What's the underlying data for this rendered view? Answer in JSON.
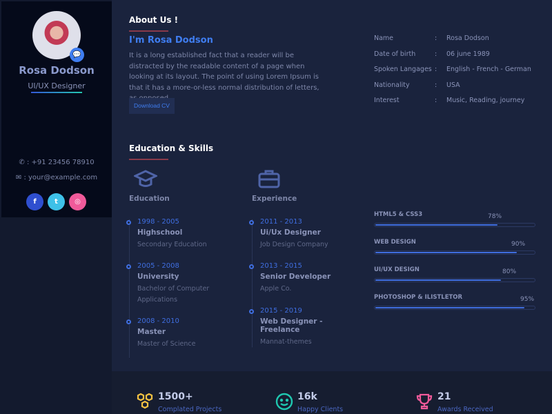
{
  "profile": {
    "name": "Rosa Dodson",
    "role": "UI/UX Designer",
    "phone": ": +91 23456 78910",
    "email": ": your@example.com",
    "socials": [
      {
        "icon": "facebook-icon",
        "glyph": "f",
        "color": "#2f4fcf"
      },
      {
        "icon": "twitter-icon",
        "glyph": "t",
        "color": "#3ec1e8"
      },
      {
        "icon": "dribbble-icon",
        "glyph": "◎",
        "color": "#f05a9a"
      }
    ]
  },
  "about": {
    "heading": "About Us !",
    "intro_name": "I'm Rosa Dodson",
    "text": "It is a long established fact that a reader will be distracted by the readable content of a page when looking at its layout. The point of using Lorem Ipsum is that it has a more-or-less normal distribution of letters, as opposed.",
    "download_label": "Download CV",
    "info": [
      {
        "k": "Name",
        "v": "Rosa Dodson"
      },
      {
        "k": "Date of birth",
        "v": "06 june 1989"
      },
      {
        "k": "Spoken Langages",
        "v": "English - French - German"
      },
      {
        "k": "Nationality",
        "v": "USA"
      },
      {
        "k": "Interest",
        "v": "Music, Reading, journey"
      }
    ],
    "sep": ":"
  },
  "edu_skills": {
    "heading": "Education & Skills",
    "education_title": "Education",
    "experience_title": "Experience",
    "education": [
      {
        "y": "1998 - 2005",
        "t": "Highschool",
        "s": "Secondary Education"
      },
      {
        "y": "2005 - 2008",
        "t": "University",
        "s": "Bachelor of Computer Applications"
      },
      {
        "y": "2008 - 2010",
        "t": "Master",
        "s": "Master of Science"
      }
    ],
    "experience": [
      {
        "y": "2011 - 2013",
        "t": "Ui/Ux Designer",
        "s": "Job Design Company"
      },
      {
        "y": "2013 - 2015",
        "t": "Senior Developer",
        "s": "Apple Co."
      },
      {
        "y": "2015 - 2019",
        "t": "Web Designer - Freelance",
        "s": "Mannat-themes"
      }
    ],
    "skills": [
      {
        "name": "HTML5 & CSS3",
        "pct": "78%",
        "value": 78
      },
      {
        "name": "WEB DESIGN",
        "pct": "90%",
        "value": 90
      },
      {
        "name": "UI/UX DESIGN",
        "pct": "80%",
        "value": 80
      },
      {
        "name": "PHOTOSHOP & ILISTLETOR",
        "pct": "95%",
        "value": 95
      }
    ]
  },
  "stats": [
    {
      "value": "1500+",
      "label": "Complated Projects",
      "color": "#f5c242"
    },
    {
      "value": "16k",
      "label": "Happy Clients",
      "color": "#1fc8b0"
    },
    {
      "value": "21",
      "label": "Awards Received",
      "color": "#f05a9a"
    }
  ]
}
